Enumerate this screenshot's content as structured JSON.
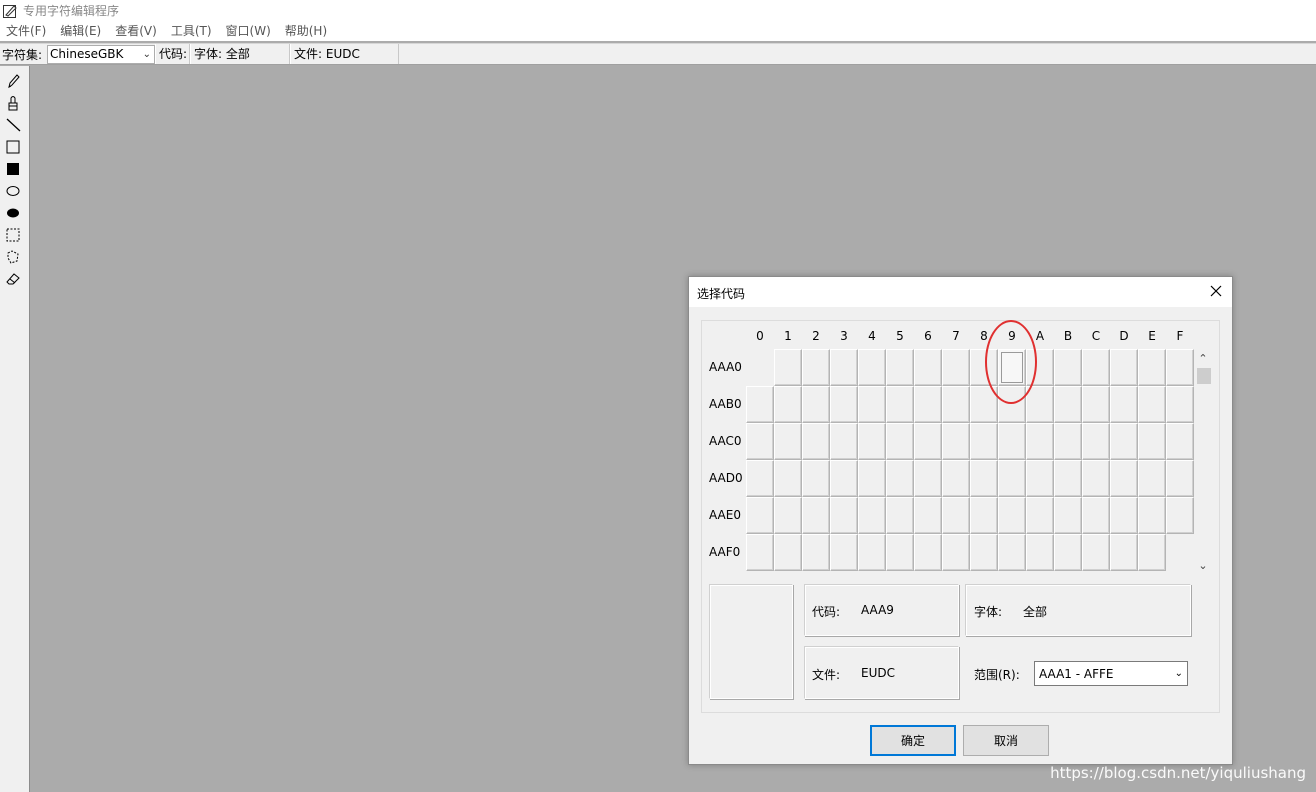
{
  "app": {
    "title": "专用字符编辑程序"
  },
  "menu": [
    "文件(F)",
    "编辑(E)",
    "查看(V)",
    "工具(T)",
    "窗口(W)",
    "帮助(H)"
  ],
  "infobar": {
    "charset_label": "字符集:",
    "charset_value": "ChineseGBK",
    "code_label": "代码:",
    "font_text": "字体: 全部",
    "file_text": "文件: EUDC"
  },
  "tools": [
    "pencil-icon",
    "brush-icon",
    "line-icon",
    "hollow-rectangle-icon",
    "filled-rectangle-icon",
    "hollow-ellipse-icon",
    "filled-ellipse-icon",
    "rect-select-icon",
    "freeform-select-icon",
    "eraser-icon"
  ],
  "dialog": {
    "title": "选择代码",
    "columns": [
      "0",
      "1",
      "2",
      "3",
      "4",
      "5",
      "6",
      "7",
      "8",
      "9",
      "A",
      "B",
      "C",
      "D",
      "E",
      "F"
    ],
    "rows": [
      "AAA0",
      "AAB0",
      "AAC0",
      "AAD0",
      "AAE0",
      "AAF0"
    ],
    "selected_cell": {
      "row": "AAA0",
      "col": "9"
    },
    "code_label": "代码:",
    "code_value": "AAA9",
    "font_label": "字体:",
    "font_value": "全部",
    "file_label": "文件:",
    "file_value": "EUDC",
    "range_label": "范围(R):",
    "range_value": "AAA1 - AFFE",
    "ok_label": "确定",
    "cancel_label": "取消"
  },
  "watermark": "https://blog.csdn.net/yiquliushang"
}
